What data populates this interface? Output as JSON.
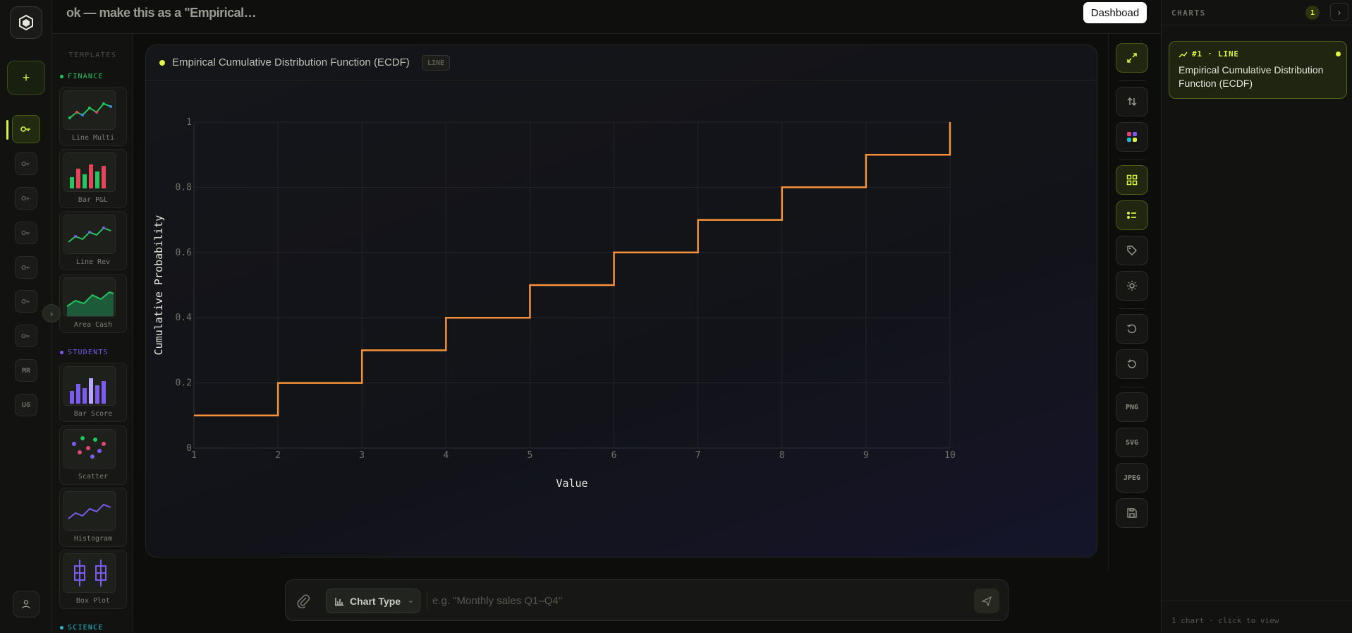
{
  "header": {
    "title": "ok — make this as a \"Empirical…",
    "dashboard_label": "Dashboad"
  },
  "rail": {
    "items": [
      {
        "label": "",
        "icon": "key-icon",
        "active": true
      },
      {
        "label": "",
        "icon": "key-icon"
      },
      {
        "label": "",
        "icon": "key-icon"
      },
      {
        "label": "",
        "icon": "key-icon"
      },
      {
        "label": "",
        "icon": "key-icon"
      },
      {
        "label": "",
        "icon": "key-icon"
      },
      {
        "label": "",
        "icon": "key-icon"
      },
      {
        "label": "MR"
      },
      {
        "label": "UG"
      }
    ],
    "mr": "MR",
    "ug": "UG",
    "toggle": "›"
  },
  "templates": {
    "heading": "TEMPLATES",
    "categories": [
      {
        "name": "FINANCE",
        "color": "#22c55e"
      },
      {
        "name": "STUDENTS",
        "color": "#7c5cf0"
      },
      {
        "name": "SCIENCE",
        "color": "#22b8cf"
      }
    ],
    "cards": [
      {
        "label": "Line Multi"
      },
      {
        "label": "Bar P&L"
      },
      {
        "label": "Line Rev"
      },
      {
        "label": "Area Cash"
      },
      {
        "label": "Bar Score"
      },
      {
        "label": "Scatter"
      },
      {
        "label": "Histogram"
      },
      {
        "label": "Box Plot"
      }
    ]
  },
  "card": {
    "title": "Empirical Cumulative Distribution Function (ECDF)",
    "badge": "LINE"
  },
  "chart_data": {
    "type": "line",
    "step": true,
    "xlabel": "Value",
    "ylabel": "Cumulative Probability",
    "x": [
      1,
      2,
      3,
      4,
      5,
      6,
      7,
      8,
      9,
      10
    ],
    "series": [
      {
        "values": [
          0.1,
          0.2,
          0.3,
          0.4,
          0.5,
          0.6,
          0.7,
          0.8,
          0.9,
          1.0
        ],
        "color": "#f5923a"
      }
    ],
    "xlim": [
      1,
      10
    ],
    "ylim": [
      0,
      1
    ],
    "xticks": [
      "1",
      "2",
      "3",
      "4",
      "5",
      "6",
      "7",
      "8",
      "9",
      "10"
    ],
    "yticks": [
      "0",
      "0.2",
      "0.4",
      "0.6",
      "0.8",
      "1"
    ],
    "grid": true
  },
  "toolbar": {
    "png": "PNG",
    "svg": "SVG",
    "jpeg": "JPEG"
  },
  "input": {
    "chart_type_label": "Chart Type",
    "placeholder": "e.g. \"Monthly sales Q1–Q4\""
  },
  "right_panel": {
    "title": "CHARTS",
    "count": "1",
    "arrow": "›",
    "item": {
      "tag": "#1 · LINE",
      "title": "Empirical Cumulative Distribution Function (ECDF)"
    },
    "footer": "1 chart · click to view"
  },
  "colors": {
    "accent": "#d7f542",
    "line": "#f5923a"
  }
}
